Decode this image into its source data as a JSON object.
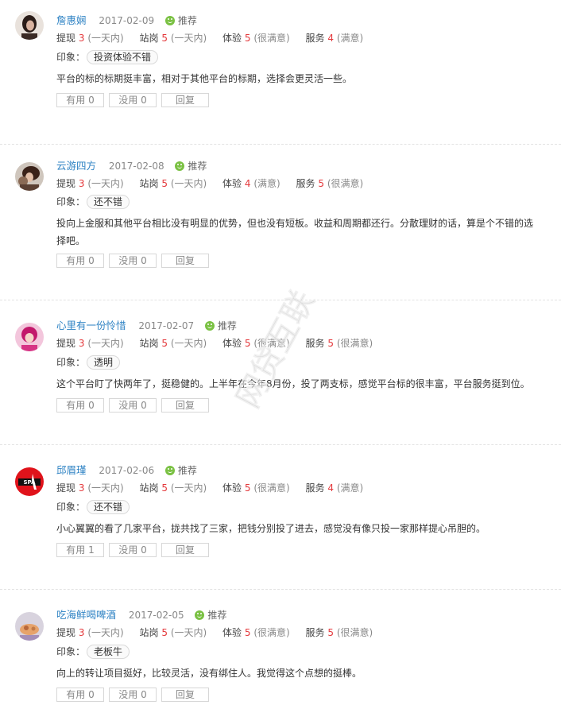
{
  "labels": {
    "recommend": "推荐",
    "impression": "印象：",
    "useful": "有用",
    "useless": "没用",
    "reply": "回复"
  },
  "reviews": [
    {
      "user": "詹惠娴",
      "date": "2017-02-09",
      "scores": [
        {
          "label": "提现",
          "value": "3",
          "level": "(一天内)"
        },
        {
          "label": "站岗",
          "value": "5",
          "level": "(一天内)"
        },
        {
          "label": "体验",
          "value": "5",
          "level": "(很满意)"
        },
        {
          "label": "服务",
          "value": "4",
          "level": "(满意)"
        }
      ],
      "tag": "投资体验不错",
      "content": "平台的标的标期挺丰富，相对于其他平台的标期，选择会更灵活一些。",
      "useful_count": "0",
      "useless_count": "0"
    },
    {
      "user": "云游四方",
      "date": "2017-02-08",
      "scores": [
        {
          "label": "提现",
          "value": "3",
          "level": "(一天内)"
        },
        {
          "label": "站岗",
          "value": "5",
          "level": "(一天内)"
        },
        {
          "label": "体验",
          "value": "4",
          "level": "(满意)"
        },
        {
          "label": "服务",
          "value": "5",
          "level": "(很满意)"
        }
      ],
      "tag": "还不错",
      "content": "投向上金服和其他平台相比没有明显的优势，但也没有短板。收益和周期都还行。分散理财的话，算是个不错的选择吧。",
      "useful_count": "0",
      "useless_count": "0"
    },
    {
      "user": "心里有一份怜惜",
      "date": "2017-02-07",
      "scores": [
        {
          "label": "提现",
          "value": "3",
          "level": "(一天内)"
        },
        {
          "label": "站岗",
          "value": "5",
          "level": "(一天内)"
        },
        {
          "label": "体验",
          "value": "5",
          "level": "(很满意)"
        },
        {
          "label": "服务",
          "value": "5",
          "level": "(很满意)"
        }
      ],
      "tag": "透明",
      "content": "这个平台盯了快两年了，挺稳健的。上半年在今年8月份，投了两支标，感觉平台标的很丰富，平台服务挺到位。",
      "useful_count": "0",
      "useless_count": "0"
    },
    {
      "user": "邱眉瑾",
      "date": "2017-02-06",
      "scores": [
        {
          "label": "提现",
          "value": "3",
          "level": "(一天内)"
        },
        {
          "label": "站岗",
          "value": "5",
          "level": "(一天内)"
        },
        {
          "label": "体验",
          "value": "5",
          "level": "(很满意)"
        },
        {
          "label": "服务",
          "value": "4",
          "level": "(满意)"
        }
      ],
      "tag": "还不错",
      "content": "小心翼翼的看了几家平台，拢共找了三家，把钱分别投了进去，感觉没有像只投一家那样提心吊胆的。",
      "useful_count": "1",
      "useless_count": "0"
    },
    {
      "user": "吃海鲜喝啤酒",
      "date": "2017-02-05",
      "scores": [
        {
          "label": "提现",
          "value": "3",
          "level": "(一天内)"
        },
        {
          "label": "站岗",
          "value": "5",
          "level": "(一天内)"
        },
        {
          "label": "体验",
          "value": "5",
          "level": "(很满意)"
        },
        {
          "label": "服务",
          "value": "5",
          "level": "(很满意)"
        }
      ],
      "tag": "老板牛",
      "content": "向上的转让项目挺好，比较灵活，没有绑住人。我觉得这个点想的挺棒。",
      "useful_count": "0",
      "useless_count": "0"
    }
  ],
  "colors": {
    "username": "#2f83c4",
    "score_number": "#e4393c",
    "recommend_icon": "#7ac143"
  },
  "watermark": "网贷互联"
}
